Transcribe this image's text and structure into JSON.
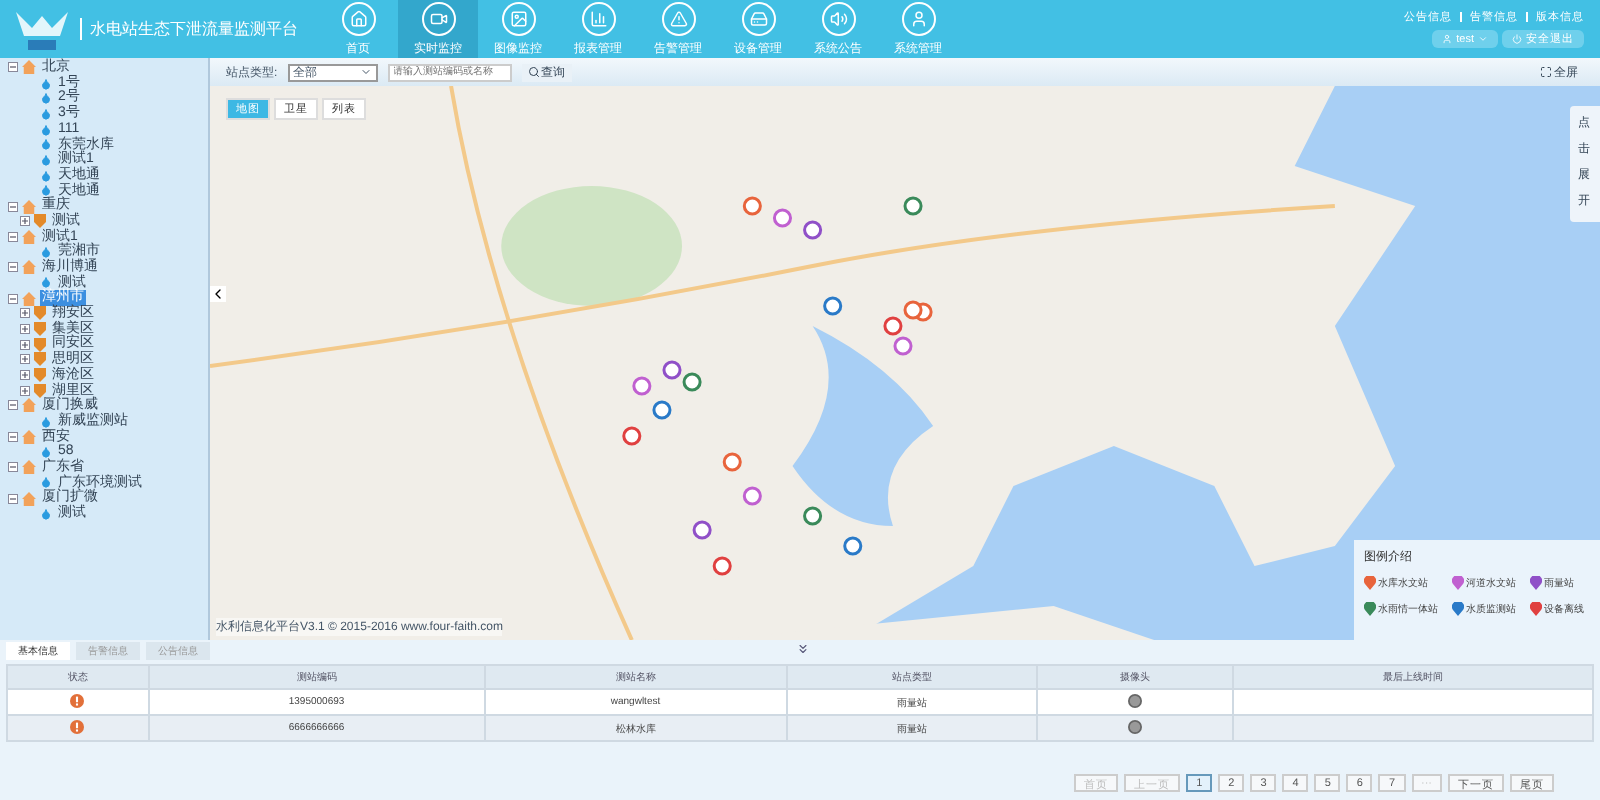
{
  "header": {
    "title": "水电站生态下泄流量监测平台",
    "nav": [
      {
        "label": "首页",
        "selected": false
      },
      {
        "label": "实时监控",
        "selected": true
      },
      {
        "label": "图像监控",
        "selected": false
      },
      {
        "label": "报表管理",
        "selected": false
      },
      {
        "label": "告警管理",
        "selected": false
      },
      {
        "label": "设备管理",
        "selected": false
      },
      {
        "label": "系统公告",
        "selected": false
      },
      {
        "label": "系统管理",
        "selected": false
      }
    ],
    "links": [
      "公告信息",
      "告警信息",
      "版本信息"
    ],
    "user_button": "test",
    "logout_button": "安全退出"
  },
  "sidebar": {
    "tree": [
      {
        "label": "北京",
        "selected": false,
        "children": [
          {
            "label": "1号",
            "kind": "station"
          },
          {
            "label": "2号",
            "kind": "station"
          },
          {
            "label": "3号",
            "kind": "station"
          },
          {
            "label": "111",
            "kind": "station"
          },
          {
            "label": "东莞水库",
            "kind": "station"
          },
          {
            "label": "测试1",
            "kind": "station"
          },
          {
            "label": "天地通",
            "kind": "station"
          },
          {
            "label": "天地通",
            "kind": "station"
          }
        ]
      },
      {
        "label": "重庆",
        "selected": false,
        "children": [
          {
            "label": "测试",
            "kind": "district"
          }
        ]
      },
      {
        "label": "测试1",
        "selected": false,
        "children": [
          {
            "label": "莞湘市",
            "kind": "station"
          }
        ]
      },
      {
        "label": "海川博通",
        "selected": false,
        "children": [
          {
            "label": "测试",
            "kind": "station"
          }
        ]
      },
      {
        "label": "漳州市",
        "selected": true,
        "children": [
          {
            "label": "翔安区",
            "kind": "district"
          },
          {
            "label": "集美区",
            "kind": "district"
          },
          {
            "label": "同安区",
            "kind": "district"
          },
          {
            "label": "思明区",
            "kind": "district"
          },
          {
            "label": "海沧区",
            "kind": "district"
          },
          {
            "label": "湖里区",
            "kind": "district"
          }
        ]
      },
      {
        "label": "厦门换威",
        "selected": false,
        "children": [
          {
            "label": "新威监测站",
            "kind": "station"
          }
        ]
      },
      {
        "label": "西安",
        "selected": false,
        "children": [
          {
            "label": "58",
            "kind": "station"
          }
        ]
      },
      {
        "label": "广东省",
        "selected": false,
        "children": [
          {
            "label": "广东环境测试",
            "kind": "station"
          }
        ]
      },
      {
        "label": "厦门扩微",
        "selected": false,
        "children": [
          {
            "label": "测试",
            "kind": "station"
          }
        ]
      }
    ]
  },
  "toolbar": {
    "type_label": "站点类型:",
    "type_value": "全部",
    "search": {
      "placeholder": "请输入测站编码或名称"
    },
    "query_button": "查询",
    "fullscreen_button": "全屏"
  },
  "map": {
    "tabs": [
      {
        "label": "地图",
        "selected": true
      },
      {
        "label": "卫星",
        "selected": false
      },
      {
        "label": "列表",
        "selected": false
      }
    ],
    "expand_tab": "点击展开",
    "credit": "水利信息化平台V3.1 © 2015-2016 www.four-faith.com",
    "legend": {
      "title": "图例介绍",
      "items": [
        {
          "label": "水库水文站",
          "color": "#e8643c"
        },
        {
          "label": "河道水文站",
          "color": "#c060d0"
        },
        {
          "label": "雨量站",
          "color": "#9050c8"
        },
        {
          "label": "水雨情一体站",
          "color": "#3a8a5a"
        },
        {
          "label": "水质监测站",
          "color": "#2a7ac8"
        },
        {
          "label": "设备离线",
          "color": "#e04040"
        }
      ]
    }
  },
  "bottom": {
    "tabs": [
      {
        "label": "基本信息",
        "selected": true
      },
      {
        "label": "告警信息",
        "selected": false
      },
      {
        "label": "公告信息",
        "selected": false
      }
    ],
    "table": {
      "columns": [
        "状态",
        "测站编码",
        "测站名称",
        "站点类型",
        "摄像头",
        "最后上线时间"
      ],
      "rows": [
        {
          "alert": true,
          "code": "1395000693",
          "name": "wangwltest",
          "type": "雨量站"
        },
        {
          "alert": true,
          "code": "6666666666",
          "name": "松林水库",
          "type": "雨量站"
        }
      ]
    },
    "pagination": [
      {
        "label": "首页",
        "disabled": true,
        "selected": false
      },
      {
        "label": "上一页",
        "disabled": true,
        "selected": false
      },
      {
        "label": "1",
        "disabled": false,
        "selected": true
      },
      {
        "label": "2",
        "disabled": false,
        "selected": false
      },
      {
        "label": "3",
        "disabled": false,
        "selected": false
      },
      {
        "label": "4",
        "disabled": false,
        "selected": false
      },
      {
        "label": "5",
        "disabled": false,
        "selected": false
      },
      {
        "label": "6",
        "disabled": false,
        "selected": false
      },
      {
        "label": "7",
        "disabled": false,
        "selected": false
      },
      {
        "label": "···",
        "disabled": true,
        "selected": false
      },
      {
        "label": "下一页",
        "disabled": false,
        "selected": false
      },
      {
        "label": "尾页",
        "disabled": false,
        "selected": false
      }
    ]
  }
}
